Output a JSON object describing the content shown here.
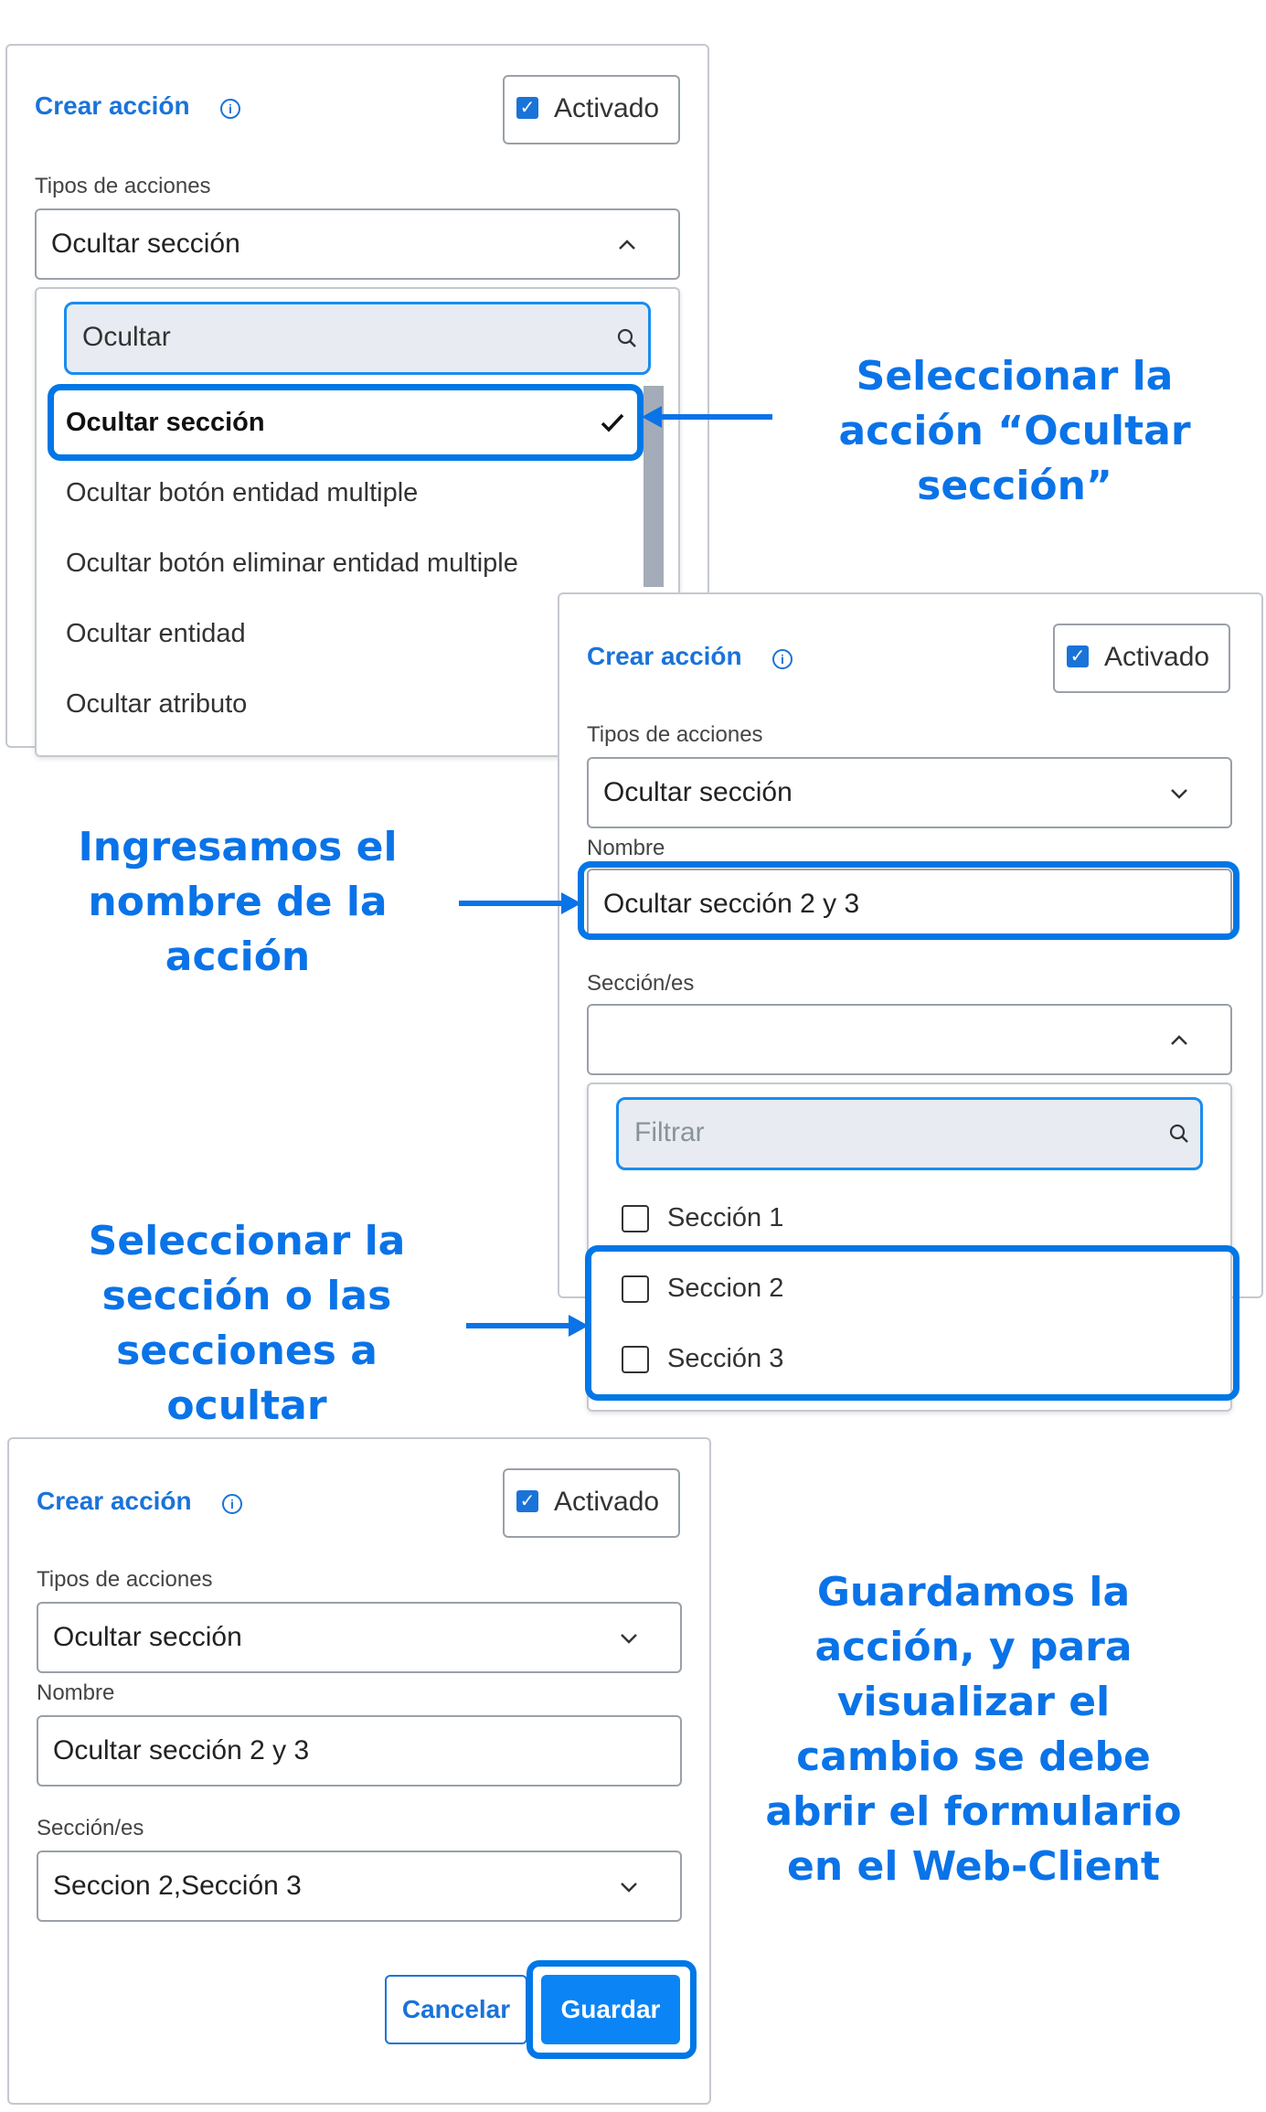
{
  "panel1": {
    "title": "Crear acción",
    "activated_label": "Activado",
    "action_types_label": "Tipos de acciones",
    "action_type_value": "Ocultar sección",
    "search_value": "Ocultar",
    "options": [
      "Ocultar sección",
      "Ocultar botón entidad multiple",
      "Ocultar botón eliminar entidad multiple",
      "Ocultar entidad",
      "Ocultar atributo"
    ]
  },
  "panel2": {
    "title": "Crear acción",
    "activated_label": "Activado",
    "action_types_label": "Tipos de acciones",
    "action_type_value": "Ocultar sección",
    "name_label": "Nombre",
    "name_value": "Ocultar sección 2 y 3",
    "sections_label": "Sección/es",
    "filter_placeholder": "Filtrar",
    "sections": [
      "Sección 1",
      "Seccion 2",
      "Sección 3"
    ]
  },
  "panel3": {
    "title": "Crear acción",
    "activated_label": "Activado",
    "action_types_label": "Tipos de acciones",
    "action_type_value": "Ocultar sección",
    "name_label": "Nombre",
    "name_value": "Ocultar sección 2 y 3",
    "sections_label": "Sección/es",
    "sections_value": "Seccion 2,Sección 3",
    "cancel_label": "Cancelar",
    "save_label": "Guardar"
  },
  "annotations": {
    "select_action": [
      "Seleccionar la",
      "acción “Ocultar",
      "sección”"
    ],
    "enter_name": [
      "Ingresamos el",
      "nombre de la",
      "acción"
    ],
    "select_sections": [
      "Seleccionar la",
      "sección o las",
      "secciones a",
      "ocultar"
    ],
    "save_note": [
      "Guardamos la",
      "acción, y para",
      "visualizar el",
      "cambio se debe",
      "abrir el formulario",
      "en el Web-Client"
    ]
  },
  "colors": {
    "accent": "#1a73d9",
    "annotation": "#0a73e8",
    "highlight": "#0077e6",
    "save_button": "#0b84f5"
  },
  "icons": [
    "info-icon",
    "checkbox-checked-icon",
    "chevron-up-icon",
    "chevron-down-icon",
    "search-icon",
    "checkmark-icon",
    "checkbox-icon",
    "arrow-left-icon",
    "arrow-right-icon"
  ]
}
